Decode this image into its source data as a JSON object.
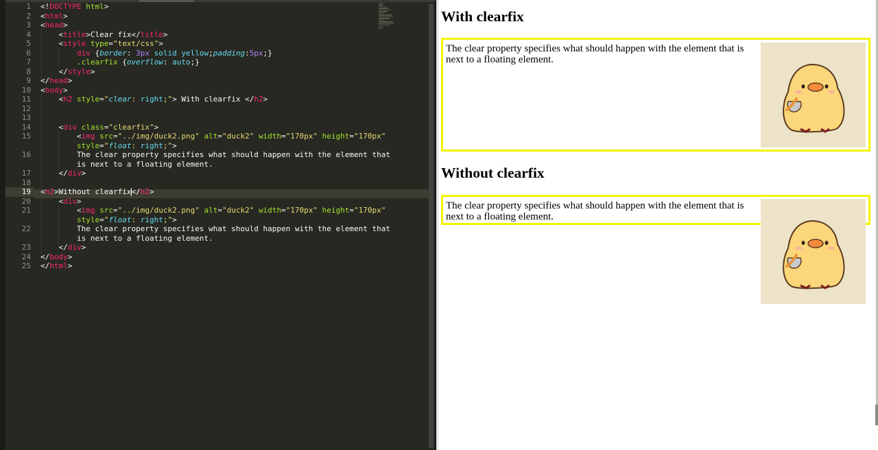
{
  "editor": {
    "line_numbers": [
      "1",
      "2",
      "3",
      "4",
      "5",
      "6",
      "7",
      "8",
      "9",
      "10",
      "11",
      "12",
      "13",
      "14",
      "15",
      "",
      "16",
      "",
      "17",
      "18",
      "19",
      "20",
      "21",
      "",
      "22",
      "",
      "23",
      "24",
      "25"
    ],
    "active_line": "19"
  },
  "preview": {
    "heading_with": "With clearfix",
    "heading_without": "Without clearfix",
    "paragraph": "The clear property specifies what should happen with the element that is next to a floating element.",
    "image_alt": "duck2"
  },
  "colors": {
    "editor_bg": "#272822",
    "border": "#f2f200",
    "duck_bg": "#ece3c8"
  }
}
